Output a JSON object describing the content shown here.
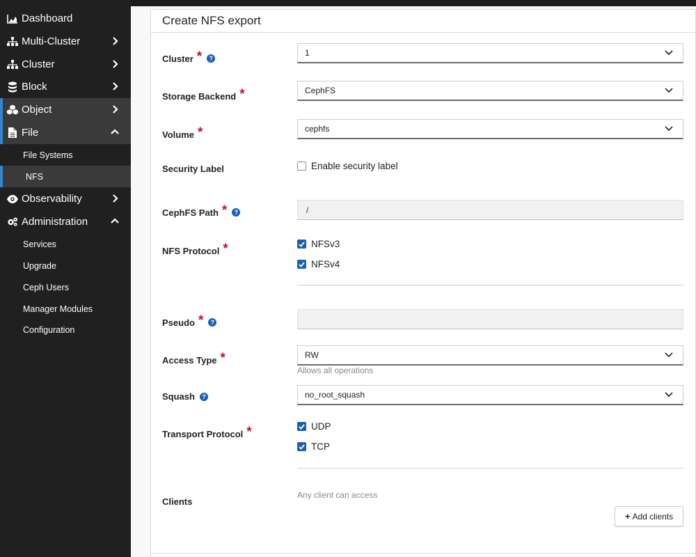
{
  "sidebar": {
    "items": [
      {
        "label": "Dashboard",
        "icon": "dashboard-icon"
      },
      {
        "label": "Multi-Cluster",
        "icon": "sitemap-icon"
      },
      {
        "label": "Cluster",
        "icon": "sitemap-icon"
      },
      {
        "label": "Block",
        "icon": "database-icon"
      },
      {
        "label": "Object",
        "icon": "cubes-icon"
      },
      {
        "label": "File",
        "icon": "file-icon"
      },
      {
        "label": "Observability",
        "icon": "eye-icon"
      },
      {
        "label": "Administration",
        "icon": "cogs-icon"
      }
    ],
    "file_sub": [
      "File Systems",
      "NFS"
    ],
    "admin_sub": [
      "Services",
      "Upgrade",
      "Ceph Users",
      "Manager Modules",
      "Configuration"
    ],
    "accent_color": "#2e86d6"
  },
  "form": {
    "title": "Create NFS export",
    "cluster": {
      "label": "Cluster",
      "value": "1"
    },
    "storage_backend": {
      "label": "Storage Backend",
      "value": "CephFS"
    },
    "volume": {
      "label": "Volume",
      "value": "cephfs"
    },
    "security_label": {
      "label": "Security Label",
      "checkbox": "Enable security label",
      "checked": false
    },
    "cephfs_path": {
      "label": "CephFS Path",
      "value": "/"
    },
    "nfs_protocol": {
      "label": "NFS Protocol",
      "options": [
        "NFSv3",
        "NFSv4"
      ],
      "checked": [
        true,
        true
      ]
    },
    "pseudo": {
      "label": "Pseudo",
      "value": ""
    },
    "access_type": {
      "label": "Access Type",
      "value": "RW",
      "hint": "Allows all operations"
    },
    "squash": {
      "label": "Squash",
      "value": "no_root_squash"
    },
    "transport_protocol": {
      "label": "Transport Protocol",
      "options": [
        "UDP",
        "TCP"
      ],
      "checked": [
        true,
        true
      ]
    },
    "clients": {
      "label": "Clients",
      "hint": "Any client can access",
      "add_button": "Add clients"
    },
    "required_color": "#c8102e",
    "check_color": "#1a5fb4"
  }
}
